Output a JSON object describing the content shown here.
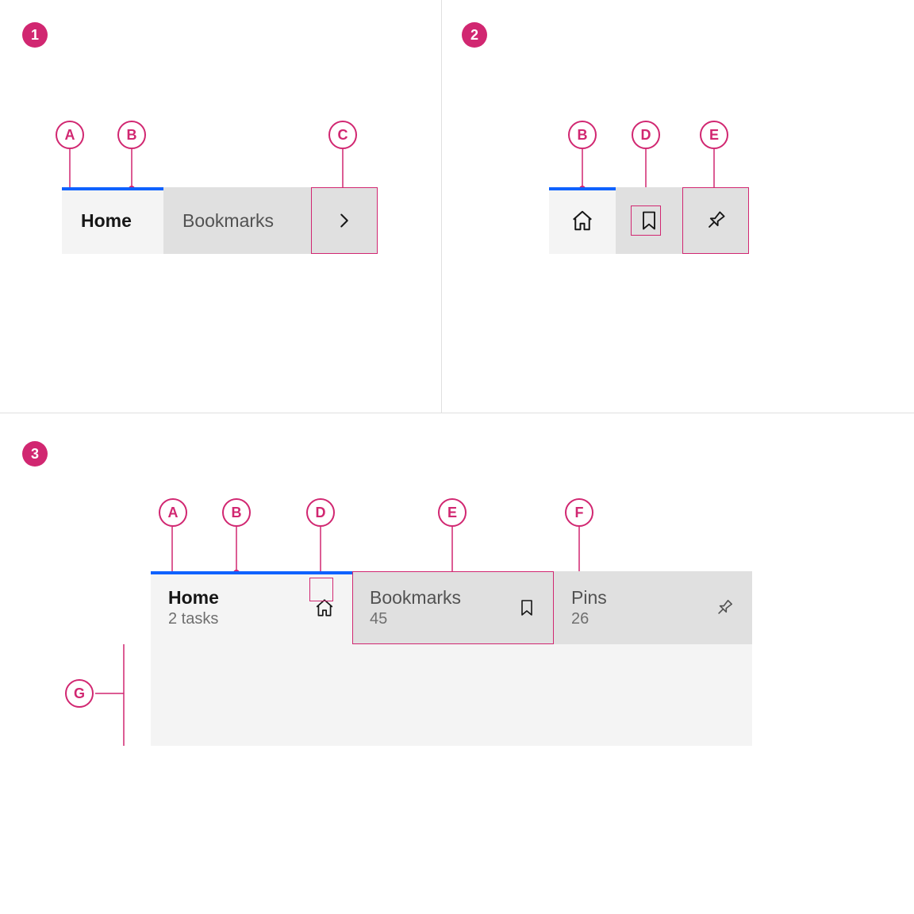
{
  "panels": {
    "one": "1",
    "two": "2",
    "three": "3"
  },
  "callouts": {
    "A": "A",
    "B": "B",
    "C": "C",
    "D": "D",
    "E": "E",
    "F": "F",
    "G": "G"
  },
  "panel1": {
    "tabs": [
      {
        "label": "Home"
      },
      {
        "label": "Bookmarks"
      }
    ]
  },
  "panel2": {
    "tabs": [
      {
        "icon": "home"
      },
      {
        "icon": "bookmark"
      },
      {
        "icon": "pin"
      }
    ]
  },
  "panel3": {
    "tabs": [
      {
        "label": "Home",
        "sub": "2 tasks",
        "icon": "home"
      },
      {
        "label": "Bookmarks",
        "sub": "45",
        "icon": "bookmark"
      },
      {
        "label": "Pins",
        "sub": "26",
        "icon": "pin"
      }
    ]
  }
}
